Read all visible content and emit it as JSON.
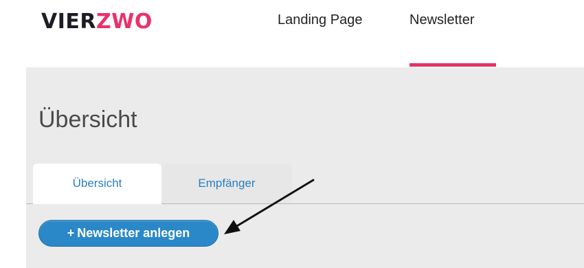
{
  "header": {
    "logo": {
      "part1": "VIER",
      "part2": "ZWO"
    },
    "nav": [
      {
        "label": "Landing Page",
        "active": false
      },
      {
        "label": "Newsletter",
        "active": true
      }
    ],
    "active_color": "#e33567"
  },
  "main": {
    "title": "Übersicht",
    "tabs": [
      {
        "label": "Übersicht",
        "active": true
      },
      {
        "label": "Empfänger",
        "active": false
      }
    ],
    "create_button": {
      "icon": "plus-icon",
      "label": "Newsletter anlegen",
      "plus": "+"
    }
  },
  "colors": {
    "brand_dark": "#1c1c24",
    "brand_pink": "#e8336d",
    "link_blue": "#2a7fc3",
    "button_blue": "#2b88c8",
    "panel_bg": "#ebebeb"
  }
}
